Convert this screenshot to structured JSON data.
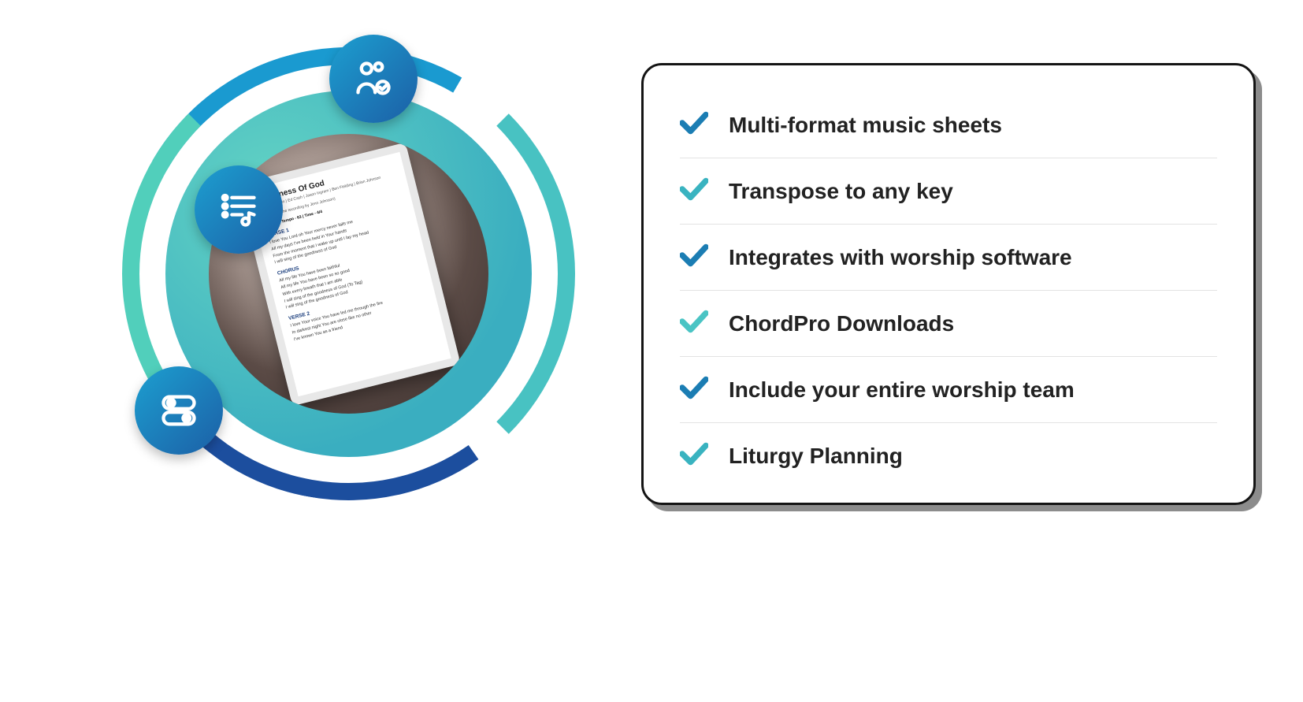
{
  "features": [
    "Multi-format music sheets",
    "Transpose to any key",
    "Integrates with worship software",
    "ChordPro Downloads",
    "Include your entire worship team",
    "Liturgy Planning"
  ],
  "check_colors": [
    "#1b7db3",
    "#39b3c0",
    "#1b7db3",
    "#4ac4c4",
    "#1b7db3",
    "#39b3c0"
  ],
  "tablet": {
    "title": "Goodness Of God",
    "credits": "Jenn Johnson | Ed Cash | Jason Ingram | Ben Fielding | Brian Johnson",
    "based_on": "(Based on the recording by Jenn Johnson)",
    "meta": "Key - A | Tempo - 63 | Time - 4/4",
    "sections": [
      {
        "name": "VERSE 1",
        "lines": [
          "I love You Lord      oh Your mercy never fails me",
          "All     my days     I've been held in Your hands",
          "From the moment that I wake  up    until I lay my head",
          "I will sing of the goodness of God"
        ]
      },
      {
        "name": "CHORUS",
        "lines": [
          "All my life You have been faithful",
          "All my life You have been so  so  good",
          "With every breath that I am able",
          "I will sing of the goodness of God   (To Tag)",
          "I will sing of the goodness of God"
        ]
      },
      {
        "name": "VERSE 2",
        "lines": [
          "I love Your voice    You have led me through the fire",
          "In darkest night     You are close like no other",
          "I've known You as a friend"
        ]
      }
    ]
  },
  "icons": {
    "people": "people-check-icon",
    "list": "music-list-icon",
    "sliders": "toggle-sliders-icon"
  }
}
